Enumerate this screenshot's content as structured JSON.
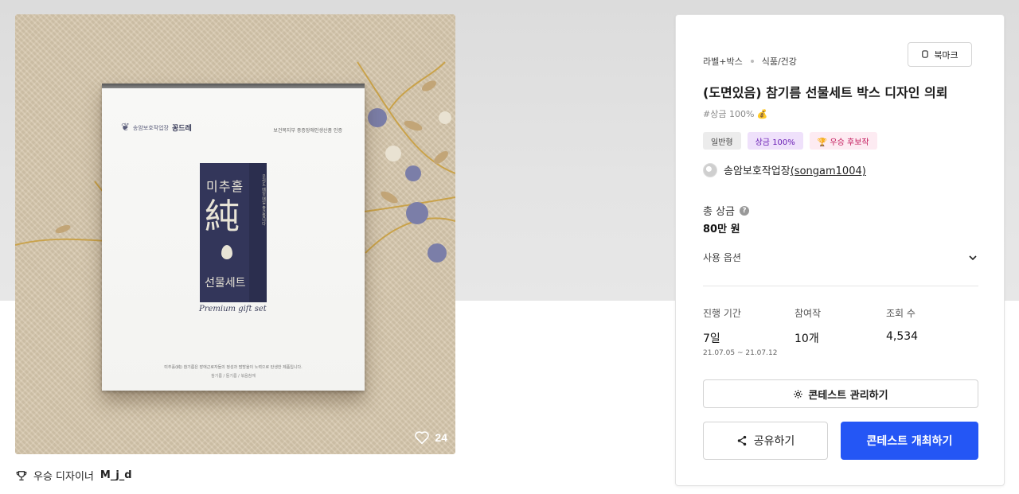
{
  "hero": {
    "likes": "24",
    "box": {
      "brand": "꽁드레",
      "org": "송암보호작업장",
      "cert": "보건복지부 중증장애인생산품 인증",
      "label_top": "미추홀",
      "label_big": "純",
      "label_bottom": "선물세트",
      "side_text": "우리도 매일 매일 출근합니다",
      "script": "Premium gift set",
      "desc": "미추홀(純) 참기름은 장애근로자들의 정성과 땀방울이 노력으로 탄생한 제품입니다.",
      "sub": "참기름 / 들기름 / 볶음참깨"
    }
  },
  "winner": {
    "label": "우승 디자이너",
    "name": "M_j_d"
  },
  "card": {
    "breadcrumb": [
      "라벨+박스",
      "식품/건강"
    ],
    "bookmark_label": "북마크",
    "title": "(도면있음) 참기름 선물세트 박스 디자인 의뢰",
    "tagline": "#상금 100% 💰",
    "badges": [
      {
        "label": "일반형",
        "color": "#ececec"
      },
      {
        "label": "상금 100%",
        "color": "#efe1fb"
      },
      {
        "label": "🏆 우승 후보작",
        "color": "#fdebf2"
      }
    ],
    "host": {
      "name": "송암보호작업장",
      "handle": "(songam1004)"
    },
    "prize": {
      "label": "총 상금",
      "value": "80만 원"
    },
    "usage_label": "사용 옵션",
    "stats": [
      {
        "label": "진행 기간",
        "value": "7일",
        "detail": "21.07.05 ~ 21.07.12"
      },
      {
        "label": "참여작",
        "value": "10개",
        "detail": ""
      },
      {
        "label": "조회 수",
        "value": "4,534",
        "detail": ""
      }
    ],
    "manage_label": "콘테스트 관리하기",
    "share_label": "공유하기",
    "host_button_label": "콘테스트 개최하기",
    "accent_color": "#2456f5"
  }
}
